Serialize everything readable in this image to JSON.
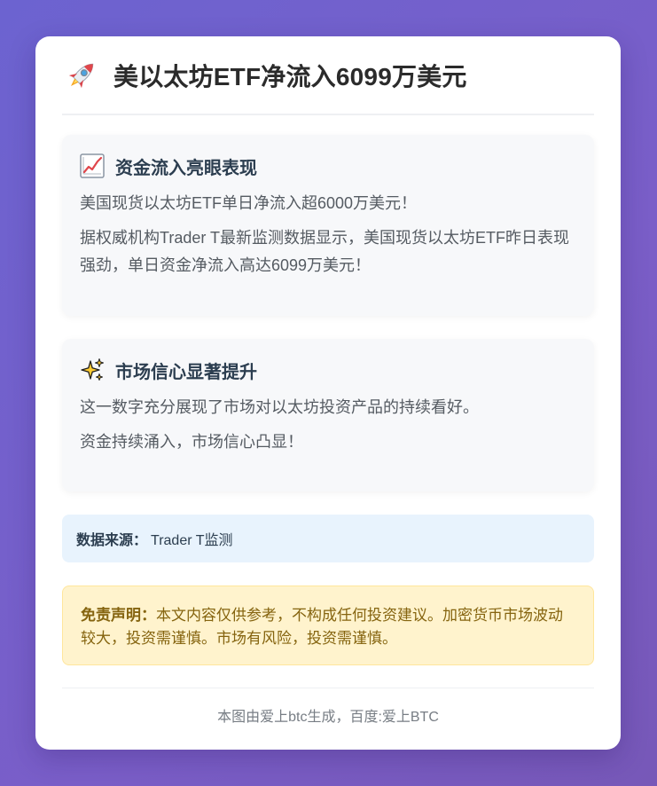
{
  "header": {
    "icon": "rocket-icon",
    "title": "美以太坊ETF净流入6099万美元"
  },
  "sections": [
    {
      "icon": "chart-increasing-icon",
      "title": "资金流入亮眼表现",
      "paragraphs": [
        "美国现货以太坊ETF单日净流入超6000万美元！",
        "据权威机构Trader T最新监测数据显示，美国现货以太坊ETF昨日表现强劲，单日资金净流入高达6099万美元！"
      ]
    },
    {
      "icon": "sparkles-icon",
      "title": "市场信心显著提升",
      "paragraphs": [
        "这一数字充分展现了市场对以太坊投资产品的持续看好。",
        "资金持续涌入，市场信心凸显！"
      ]
    }
  ],
  "source": {
    "label": "数据来源：",
    "value": "Trader T监测"
  },
  "disclaimer": {
    "label": "免责声明：",
    "text": "本文内容仅供参考，不构成任何投资建议。加密货币市场波动较大，投资需谨慎。市场有风险，投资需谨慎。"
  },
  "footer": {
    "text": "本图由爱上btc生成，百度:爱上BTC"
  },
  "colors": {
    "background_gradient_start": "#6c63d0",
    "background_gradient_end": "#7758b8",
    "card": "#ffffff",
    "section_bg": "#f7f8fa",
    "source_bg": "#e8f3fd",
    "disclaimer_bg": "#fff3cd",
    "disclaimer_text": "#85640f"
  }
}
